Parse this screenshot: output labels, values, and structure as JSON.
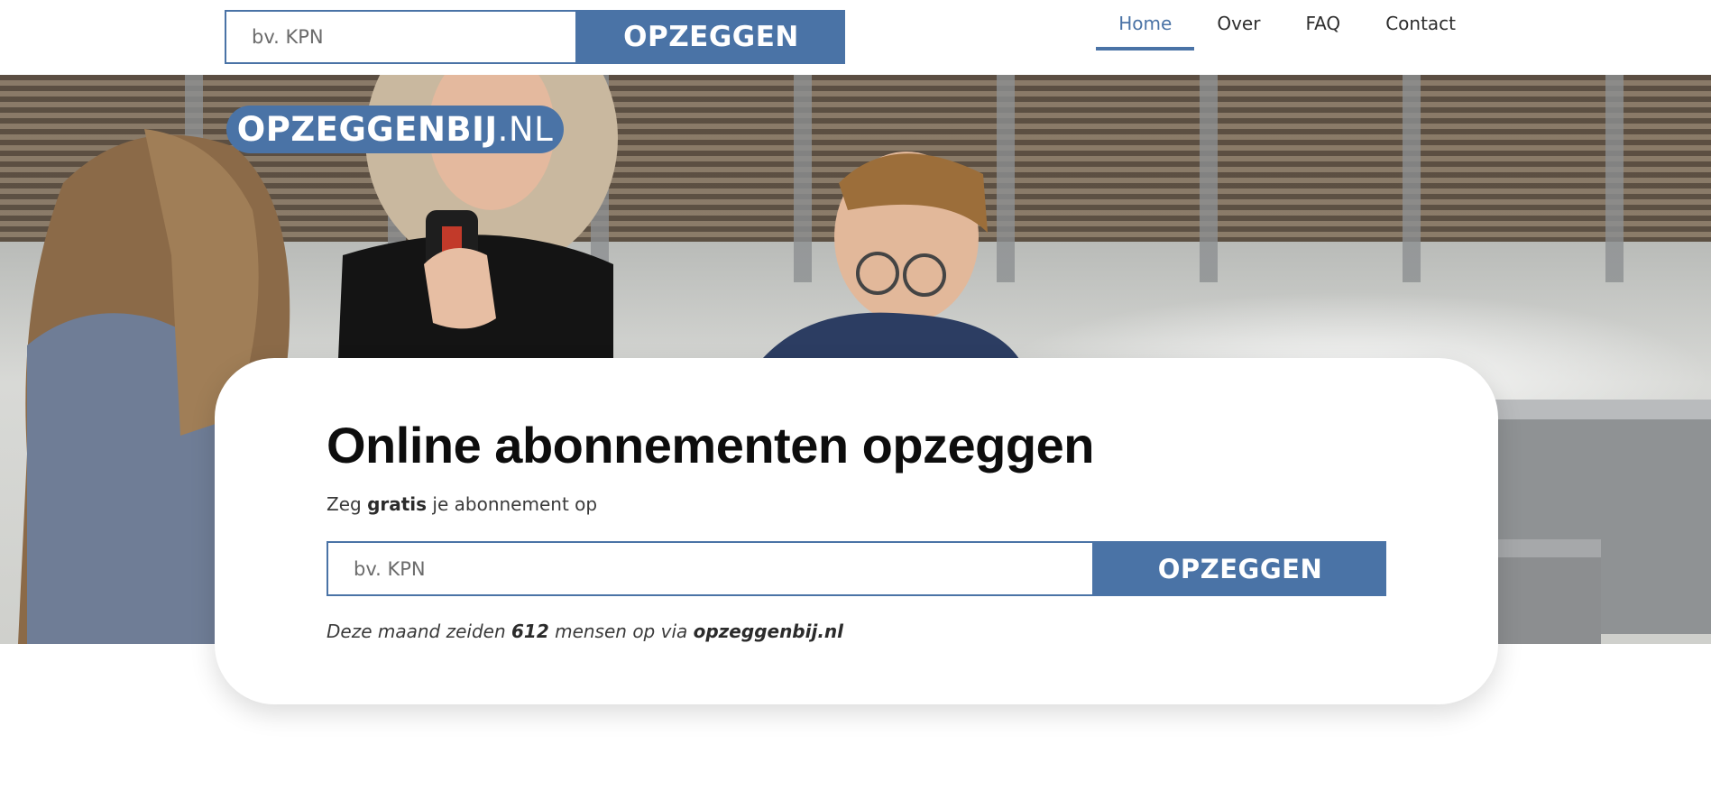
{
  "header": {
    "search": {
      "placeholder": "bv. KPN",
      "button_label": "OPZEGGEN"
    },
    "nav": [
      {
        "label": "Home",
        "active": true
      },
      {
        "label": "Over",
        "active": false
      },
      {
        "label": "FAQ",
        "active": false
      },
      {
        "label": "Contact",
        "active": false
      }
    ]
  },
  "logo": {
    "name": "OPZEGGENBIJ",
    "tld": ".NL"
  },
  "hero": {
    "title": "Online abonnementen opzeggen",
    "subtitle": {
      "before": "Zeg ",
      "bold": "gratis",
      "after": " je abonnement op"
    },
    "search": {
      "placeholder": "bv. KPN",
      "button_label": "OPZEGGEN"
    },
    "stat": {
      "before": "Deze maand zeiden ",
      "count": "612",
      "middle": " mensen op via ",
      "site": "opzeggenbij.nl"
    }
  },
  "colors": {
    "accent": "#4a73a6",
    "background": "#ffffff",
    "text": "#2b2b2b"
  }
}
